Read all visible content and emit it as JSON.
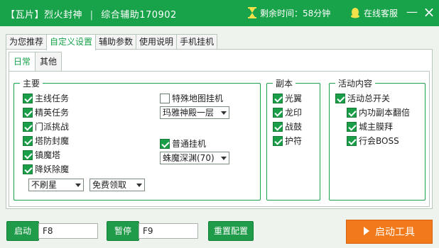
{
  "titlebar": {
    "title_prefix": "【瓦片】烈火封神",
    "title_sep": "|",
    "title_suffix": "综合辅助170902",
    "remaining_time": "剩余时间：58分钟",
    "service": "在线客服",
    "minimize": "—",
    "close": "×"
  },
  "tabs": [
    "为您推荐",
    "自定义设置",
    "辅助参数",
    "使用说明",
    "手机挂机"
  ],
  "subtabs": [
    "日常",
    "其他"
  ],
  "main_group": {
    "legend": "主要",
    "tasks": [
      {
        "label": "主线任务",
        "checked": true
      },
      {
        "label": "精英任务",
        "checked": true
      },
      {
        "label": "门派挑战",
        "checked": true
      },
      {
        "label": "塔防封魔",
        "checked": true
      },
      {
        "label": "镇魔塔",
        "checked": true
      },
      {
        "label": "降妖除魔",
        "checked": true
      }
    ],
    "dropdown_star": "不刷星",
    "dropdown_claim": "免费领取",
    "special_map": {
      "label": "特殊地图挂机",
      "checked": false
    },
    "special_map_select": "玛雅神殿一层",
    "normal_hang": {
      "label": "普通挂机",
      "checked": true
    },
    "normal_hang_select": "蛛魔深渊(70)"
  },
  "dungeon_group": {
    "legend": "副本",
    "items": [
      {
        "label": "光翼",
        "checked": true
      },
      {
        "label": "龙印",
        "checked": true
      },
      {
        "label": "战鼓",
        "checked": true
      },
      {
        "label": "护符",
        "checked": true
      }
    ]
  },
  "activity_group": {
    "legend": "活动内容",
    "master": {
      "label": "活动总开关",
      "checked": true
    },
    "items": [
      {
        "label": "内功副本翻倍",
        "checked": true
      },
      {
        "label": "城主膜拜",
        "checked": true
      },
      {
        "label": "行会BOSS",
        "checked": true
      }
    ]
  },
  "bottom": {
    "start_label": "启动",
    "start_key": "F8",
    "pause_label": "暂停",
    "pause_key": "F9",
    "reset_label": "重置配置",
    "launch_label": "启动工具"
  },
  "colors": {
    "accent": "#18a24a",
    "launch": "#f27a1a"
  }
}
